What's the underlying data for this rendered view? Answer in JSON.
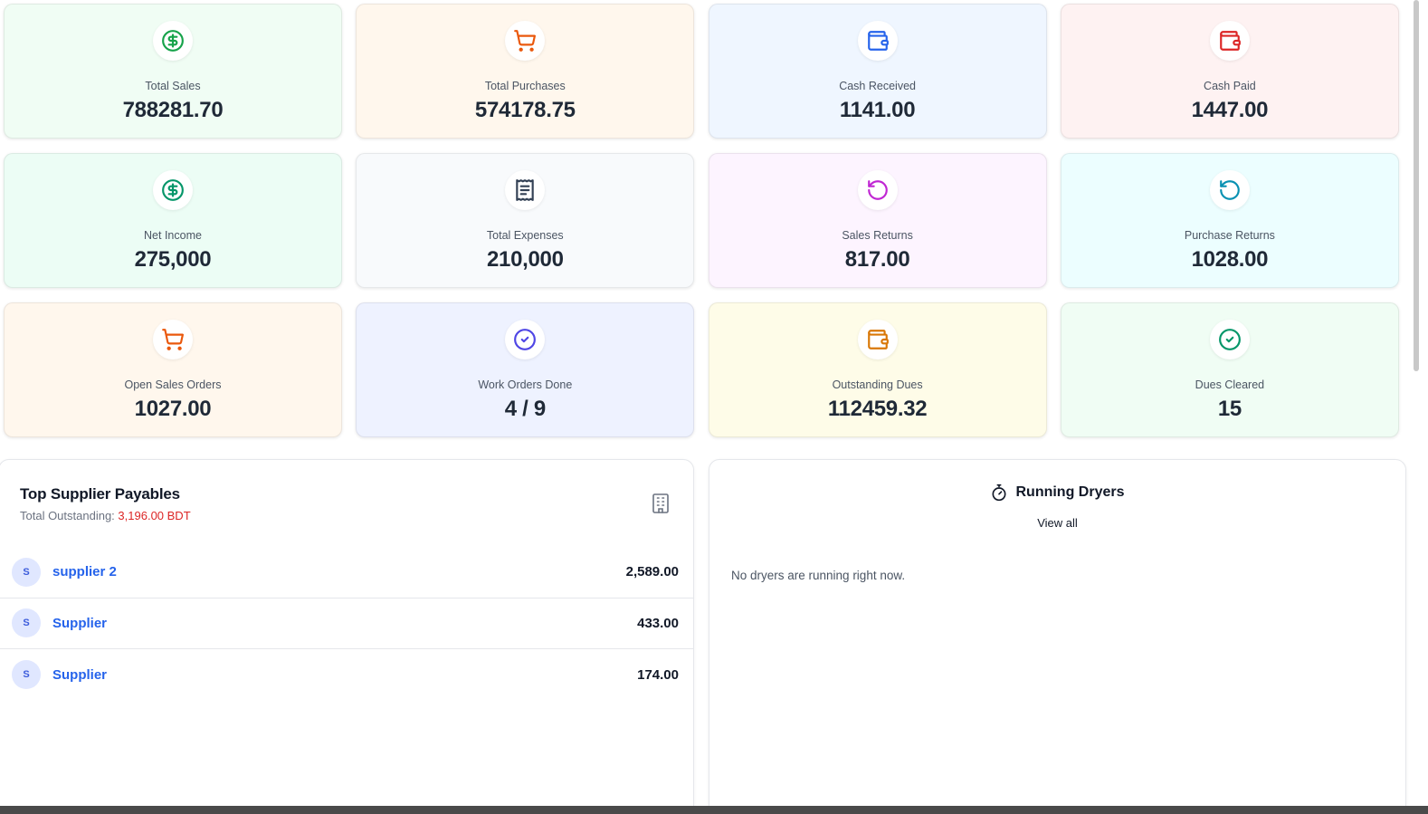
{
  "stats": [
    {
      "label": "Total Sales",
      "value": "788281.70",
      "icon": "dollar-icon",
      "bg": "#f0fdf4",
      "color": "#16a34a"
    },
    {
      "label": "Total Purchases",
      "value": "574178.75",
      "icon": "cart-icon",
      "bg": "#fff7ed",
      "color": "#ea580c"
    },
    {
      "label": "Cash Received",
      "value": "1141.00",
      "icon": "wallet-icon",
      "bg": "#eff6ff",
      "color": "#2563eb"
    },
    {
      "label": "Cash Paid",
      "value": "1447.00",
      "icon": "wallet-icon",
      "bg": "#fef2f2",
      "color": "#dc2626"
    },
    {
      "label": "Net Income",
      "value": "275,000",
      "icon": "dollar-icon",
      "bg": "#ecfdf5",
      "color": "#059669"
    },
    {
      "label": "Total Expenses",
      "value": "210,000",
      "icon": "receipt-icon",
      "bg": "#f8fafc",
      "color": "#334155"
    },
    {
      "label": "Sales Returns",
      "value": "817.00",
      "icon": "rotate-ccw-icon",
      "bg": "#fdf4ff",
      "color": "#c026d3"
    },
    {
      "label": "Purchase Returns",
      "value": "1028.00",
      "icon": "rotate-ccw-icon",
      "bg": "#ecfeff",
      "color": "#0891b2"
    },
    {
      "label": "Open Sales Orders",
      "value": "1027.00",
      "icon": "cart-icon",
      "bg": "#fff7ed",
      "color": "#ea580c"
    },
    {
      "label": "Work Orders Done",
      "value": "4 / 9",
      "icon": "check-circle-icon",
      "bg": "#eef2ff",
      "color": "#4f46e5"
    },
    {
      "label": "Outstanding Dues",
      "value": "112459.32",
      "icon": "wallet-icon",
      "bg": "#fefce8",
      "color": "#d97706"
    },
    {
      "label": "Dues Cleared",
      "value": "15",
      "icon": "check-circle-icon",
      "bg": "#f0fdf4",
      "color": "#059669"
    }
  ],
  "suppliers": {
    "title": "Top Supplier Payables",
    "total_label": "Total Outstanding:",
    "total_value": "3,196.00 BDT",
    "icon": "building-icon",
    "rows": [
      {
        "initial": "S",
        "name": "supplier 2",
        "amount": "2,589.00"
      },
      {
        "initial": "S",
        "name": "Supplier",
        "amount": "433.00"
      },
      {
        "initial": "S",
        "name": "Supplier",
        "amount": "174.00"
      }
    ]
  },
  "dryers": {
    "title": "Running Dryers",
    "icon": "stopwatch-icon",
    "view_all": "View all",
    "empty_text": "No dryers are running right now."
  }
}
